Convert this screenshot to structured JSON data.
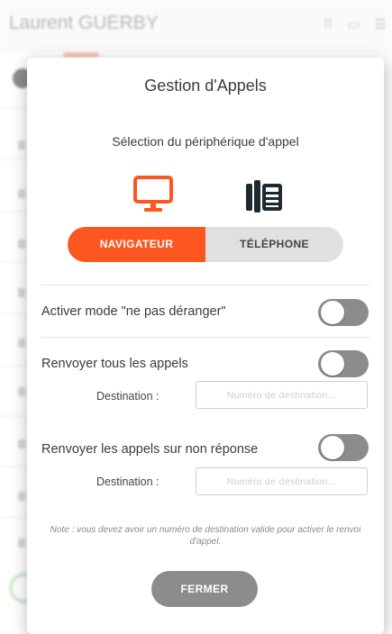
{
  "background": {
    "app_title": "Laurent GUERBY",
    "header_icons": [
      "keypad-icon",
      "monitor-icon",
      "menu-icon"
    ]
  },
  "modal": {
    "title": "Gestion d'Appels",
    "device_section": {
      "label": "Sélection du périphérique d'appel",
      "icons": [
        "monitor-icon",
        "desk-phone-icon"
      ],
      "options": [
        {
          "label": "NAVIGATEUR",
          "selected": true
        },
        {
          "label": "TÉLÉPHONE",
          "selected": false
        }
      ]
    },
    "dnd": {
      "label": "Activer mode \"ne pas déranger\"",
      "enabled": false
    },
    "forward_all": {
      "label": "Renvoyer tous les appels",
      "enabled": false,
      "destination_label": "Destination :",
      "destination_placeholder": "Numéro de destination..."
    },
    "forward_no_answer": {
      "label": "Renvoyer les appels sur non réponse",
      "enabled": false,
      "destination_label": "Destination :",
      "destination_placeholder": "Numéro de destination..."
    },
    "note": "Note : vous devez avoir un numéro de destination valide pour activer le renvoi d'appel.",
    "close_label": "FERMER"
  },
  "colors": {
    "accent": "#fe5621",
    "toggle_off": "#8c8c8c",
    "close_button": "#8c8c8c"
  }
}
